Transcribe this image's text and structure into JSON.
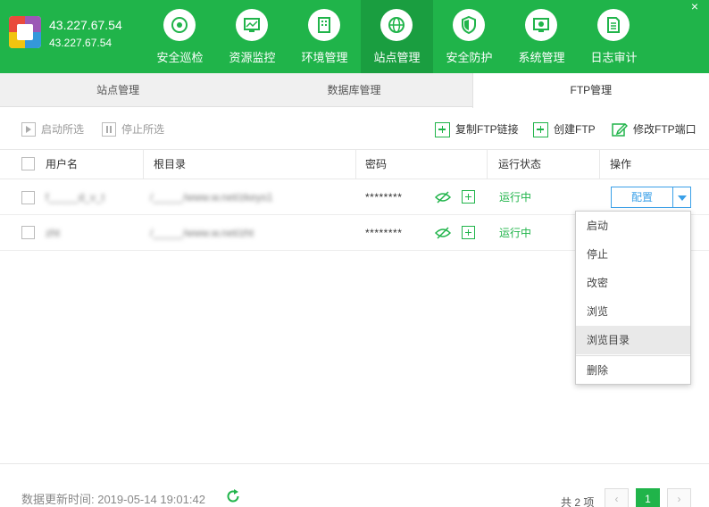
{
  "header": {
    "server_ip": "43.227.67.54",
    "server_ip_sub": "43.227.67.54",
    "close": "×",
    "nav": [
      {
        "label": "安全巡检",
        "icon": "eye-scan-icon"
      },
      {
        "label": "资源监控",
        "icon": "monitor-chart-icon"
      },
      {
        "label": "环境管理",
        "icon": "building-icon"
      },
      {
        "label": "站点管理",
        "icon": "globe-icon",
        "active": true
      },
      {
        "label": "安全防护",
        "icon": "shield-icon"
      },
      {
        "label": "系统管理",
        "icon": "system-monitor-icon"
      },
      {
        "label": "日志审计",
        "icon": "document-icon"
      }
    ]
  },
  "tabs": [
    {
      "label": "站点管理"
    },
    {
      "label": "数据库管理"
    },
    {
      "label": "FTP管理",
      "active": true
    }
  ],
  "toolbar": {
    "start_selected": "启动所选",
    "stop_selected": "停止所选",
    "copy_link": "复制FTP链接",
    "create_ftp": "创建FTP",
    "modify_port": "修改FTP端口"
  },
  "table": {
    "headers": {
      "username": "用户名",
      "root": "根目录",
      "password": "密码",
      "status": "运行状态",
      "action": "操作"
    },
    "rows": [
      {
        "username": "f_____d_v_t",
        "root": "/_____/www.w.net/zkeys1",
        "password": "********",
        "status": "运行中"
      },
      {
        "username": "zht",
        "root": "/_____/www.w.net/zht",
        "password": "********",
        "status": "运行中"
      }
    ],
    "config_label": "配置"
  },
  "dropdown": {
    "items": [
      "启动",
      "停止",
      "改密",
      "浏览",
      "浏览目录",
      "删除"
    ],
    "hover_index": 4
  },
  "footer": {
    "update_label": "数据更新时间: 2019-05-14 19:01:42",
    "total": "共 2 项",
    "prev": "‹",
    "page": "1",
    "next": "›"
  },
  "colors": {
    "brand_green": "#20b44a",
    "active_nav": "#1a9e40",
    "link_blue": "#3aa0e8"
  }
}
